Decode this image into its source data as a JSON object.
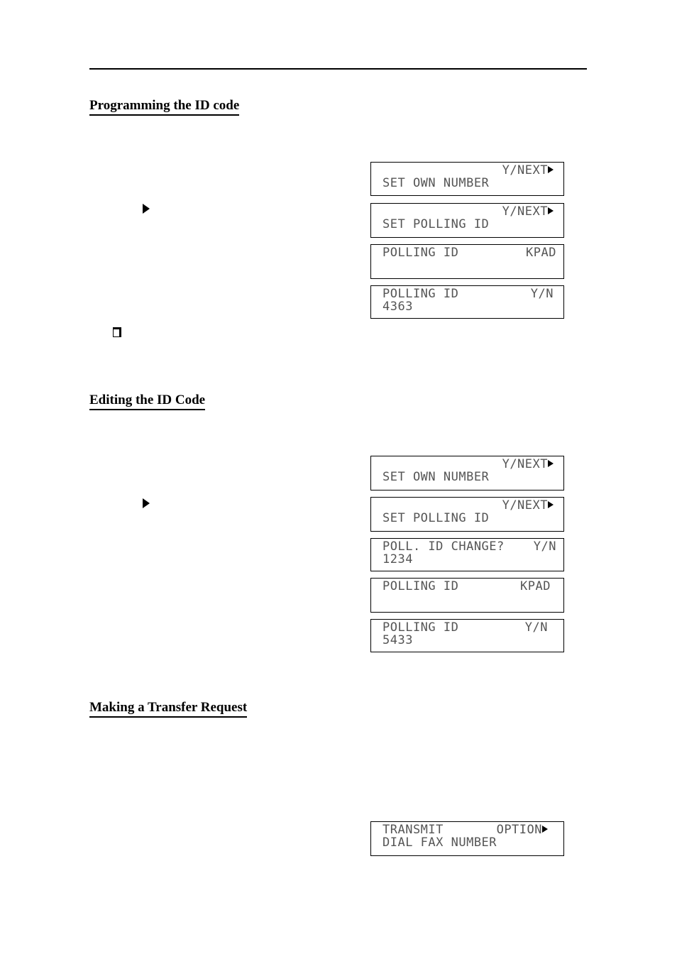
{
  "sections": [
    {
      "title": "Programming the ID code"
    },
    {
      "title": "Editing the ID Code"
    },
    {
      "title": "Making a Transfer Request"
    }
  ],
  "displays": [
    {
      "l1_left": "",
      "l1_right": "Y/NEXT",
      "arrow": true,
      "l2": "SET OWN NUMBER"
    },
    {
      "l1_left": "",
      "l1_right": "Y/NEXT",
      "arrow": true,
      "l2": "SET POLLING ID"
    },
    {
      "l1_left": "POLLING ID",
      "l1_right": "KPAD",
      "arrow": false,
      "l2": ""
    },
    {
      "l1_left": "POLLING ID",
      "l1_right": "Y/N",
      "arrow": false,
      "l2": "4363"
    },
    {
      "l1_left": "",
      "l1_right": "Y/NEXT",
      "arrow": true,
      "l2": "SET OWN NUMBER"
    },
    {
      "l1_left": "",
      "l1_right": "Y/NEXT",
      "arrow": true,
      "l2": "SET POLLING ID"
    },
    {
      "l1_left": "POLL. ID CHANGE?",
      "l1_right": "Y/N",
      "arrow": false,
      "l2": "1234"
    },
    {
      "l1_left": "POLLING ID",
      "l1_right": "KPAD",
      "arrow": false,
      "l2": ""
    },
    {
      "l1_left": "POLLING ID",
      "l1_right": "Y/N",
      "arrow": false,
      "l2": "5433"
    },
    {
      "l1_left": "TRANSMIT",
      "l1_right": "OPTION",
      "arrow": true,
      "l2": "DIAL FAX NUMBER"
    }
  ]
}
